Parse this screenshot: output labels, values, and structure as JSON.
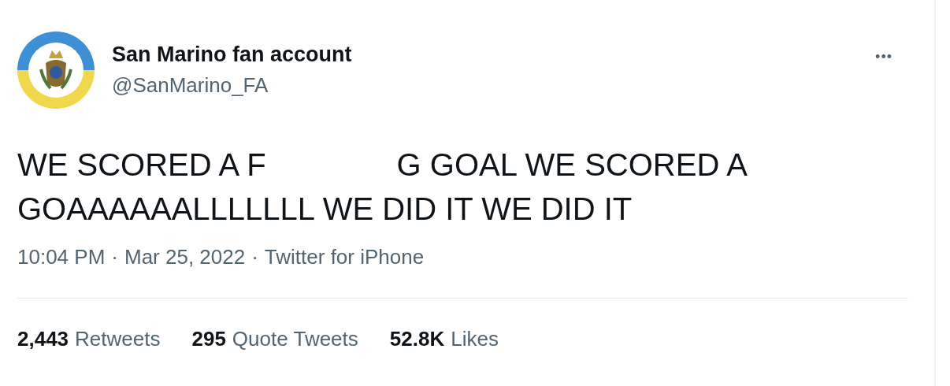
{
  "author": {
    "name": "San Marino fan account",
    "handle": "@SanMarino_FA"
  },
  "more_menu": "•••",
  "tweet": {
    "line_1": [
      "WE SCORED A F",
      "G GOAL WE SCORED A"
    ],
    "line_2": "GOAAAAAALLLLLLL WE DID IT WE DID IT"
  },
  "meta": [
    "10:04 PM",
    "·",
    "Mar 25, 2022",
    "·",
    "Twitter for iPhone"
  ],
  "stats": [
    {
      "count": "2,443",
      "label": "Retweets"
    },
    {
      "count": "295",
      "label": "Quote Tweets"
    },
    {
      "count": "52.8K",
      "label": "Likes"
    }
  ]
}
